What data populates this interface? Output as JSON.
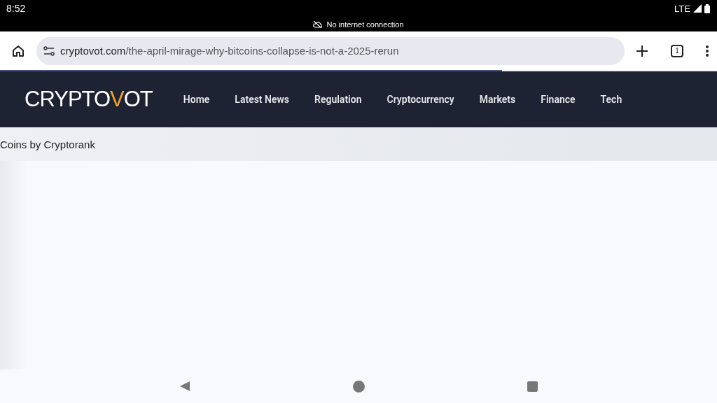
{
  "status_bar": {
    "time": "8:52",
    "network": "LTE",
    "notice": "No internet connection"
  },
  "browser": {
    "url_domain": "cryptovot.com",
    "url_path": "/the-april-mirage-why-bitcoins-collapse-is-not-a-2025-rerun",
    "tab_count": "1",
    "load_progress": {
      "level": 0.7
    }
  },
  "site": {
    "logo": {
      "before": "CRYPTO",
      "accent": "V",
      "after": "OT"
    },
    "nav": [
      "Home",
      "Latest News",
      "Regulation",
      "Cryptocurrency",
      "Markets",
      "Finance",
      "Tech"
    ],
    "ticker": "Coins by Cryptorank"
  }
}
